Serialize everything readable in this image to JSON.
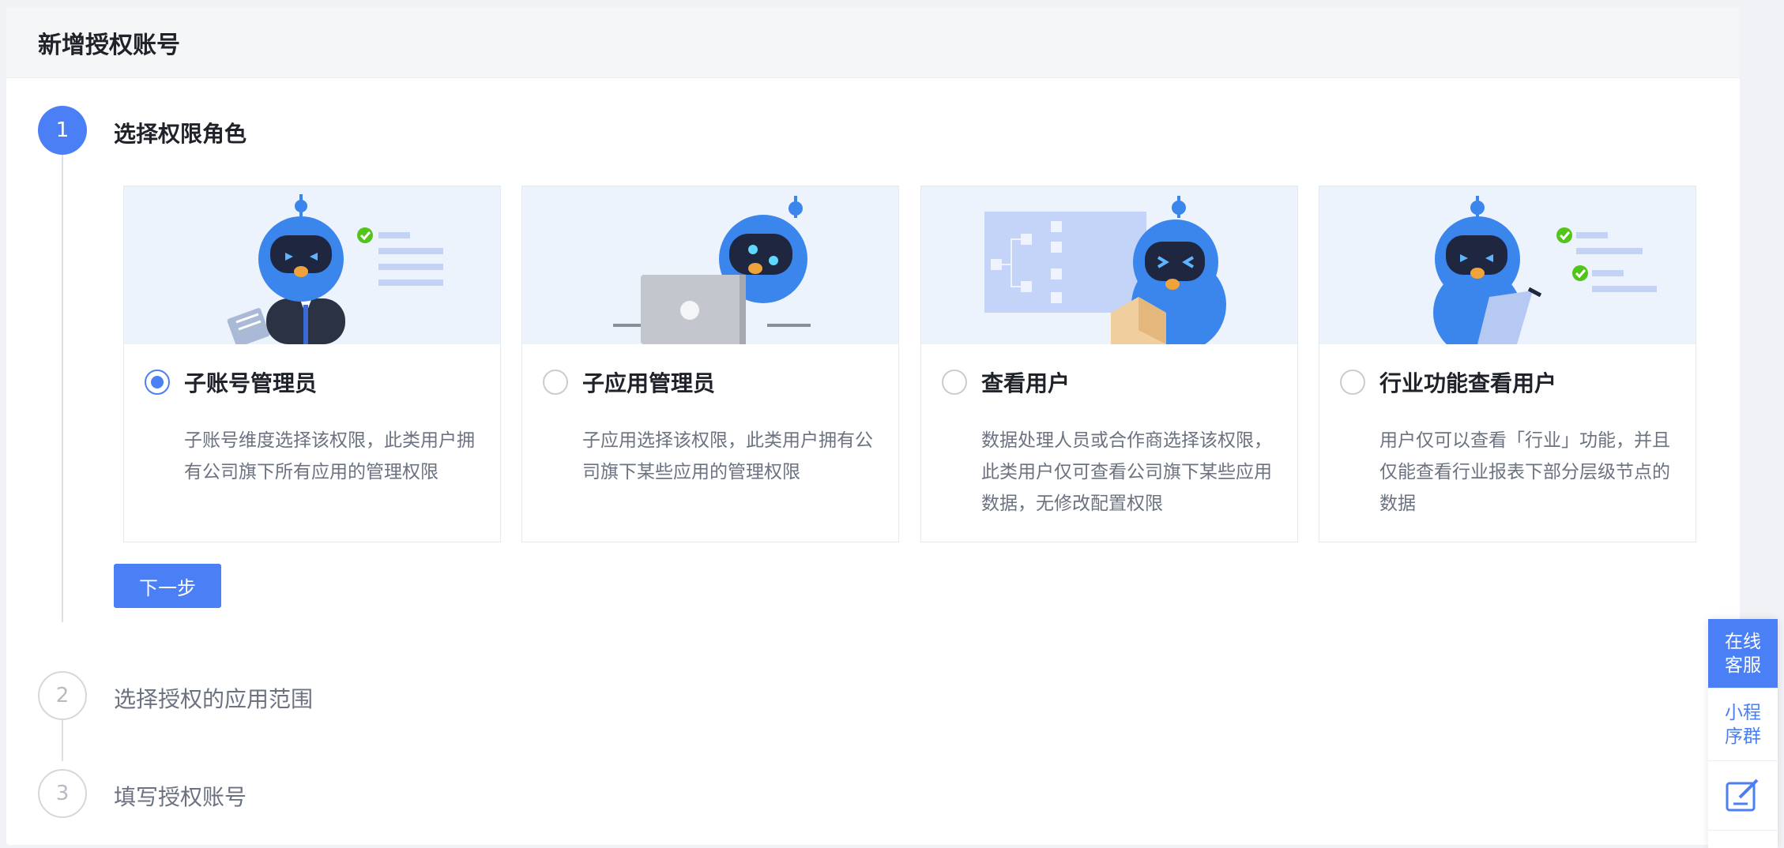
{
  "page": {
    "title": "新增授权账号"
  },
  "steps": [
    {
      "number": "1",
      "title": "选择权限角色",
      "state": "active"
    },
    {
      "number": "2",
      "title": "选择授权的应用范围",
      "state": "inactive"
    },
    {
      "number": "3",
      "title": "填写授权账号",
      "state": "inactive"
    }
  ],
  "roles": [
    {
      "title": "子账号管理员",
      "description": "子账号维度选择该权限，此类用户拥有公司旗下所有应用的管理权限",
      "selected": true,
      "illustration": "robot-with-document-and-checklist"
    },
    {
      "title": "子应用管理员",
      "description": "子应用选择该权限，此类用户拥有公司旗下某些应用的管理权限",
      "selected": false,
      "illustration": "robot-with-laptop"
    },
    {
      "title": "查看用户",
      "description": "数据处理人员或合作商选择该权限，此类用户仅可查看公司旗下某些应用数据，无修改配置权限",
      "selected": false,
      "illustration": "robot-reading-with-flowchart"
    },
    {
      "title": "行业功能查看用户",
      "description": "用户仅可以查看「行业」功能，并且仅能查看行业报表下部分层级节点的数据",
      "selected": false,
      "illustration": "robot-with-clipboard-and-checklist"
    }
  ],
  "actions": {
    "next_label": "下一步"
  },
  "float_bar": {
    "support_label": "在线客服",
    "miniprogram_label": "小程序群",
    "feedback_icon": "edit-icon"
  },
  "colors": {
    "primary": "#4a7ff5",
    "illustration_bg": "#edf3fd"
  }
}
